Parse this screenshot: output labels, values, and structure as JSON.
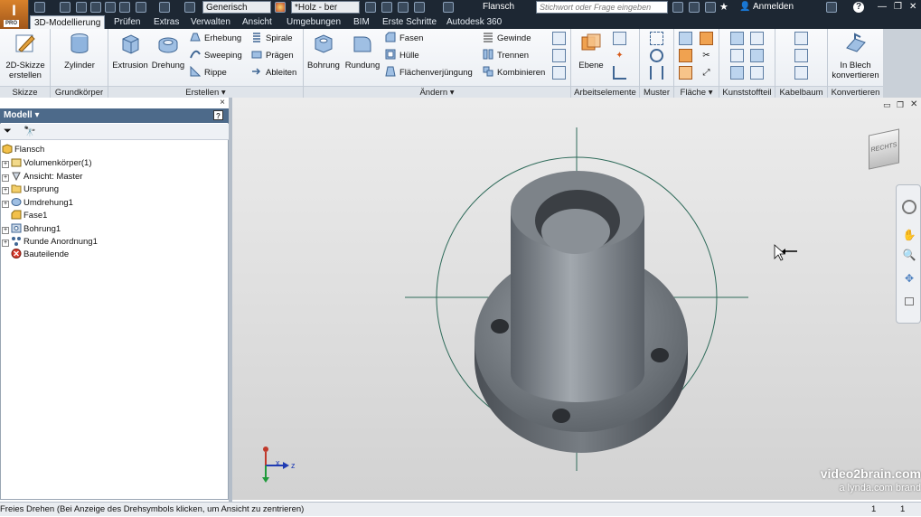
{
  "titlebar": {
    "material": "Generisch",
    "appearance": "*Holz - ber",
    "document": "Flansch",
    "search_placeholder": "Stichwort oder Frage eingeben",
    "signin": "Anmelden"
  },
  "app": {
    "logo_letter": "I",
    "logo_badge": "PRO"
  },
  "tabs": [
    "3D-Modellierung",
    "Prüfen",
    "Extras",
    "Verwalten",
    "Ansicht",
    "Umgebungen",
    "BIM",
    "Erste Schritte",
    "Autodesk 360"
  ],
  "ribbon": {
    "skizze": {
      "title": "Skizze",
      "btn": "2D-Skizze erstellen"
    },
    "grund": {
      "title": "Grundkörper",
      "btn": "Zylinder"
    },
    "erstellen": {
      "title": "Erstellen",
      "extrusion": "Extrusion",
      "drehung": "Drehung",
      "erhebung": "Erhebung",
      "sweeping": "Sweeping",
      "rippe": "Rippe",
      "spirale": "Spirale",
      "praegen": "Prägen",
      "ableiten": "Ableiten"
    },
    "aendern": {
      "title": "Ändern",
      "bohrung": "Bohrung",
      "rundung": "Rundung",
      "fasen": "Fasen",
      "huelle": "Hülle",
      "flaechen": "Flächenverjüngung",
      "gewinde": "Gewinde",
      "trennen": "Trennen",
      "kombinieren": "Kombinieren"
    },
    "arbeit": {
      "title": "Arbeitselemente",
      "ebene": "Ebene"
    },
    "muster": {
      "title": "Muster"
    },
    "flaeche": {
      "title": "Fläche"
    },
    "kunst": {
      "title": "Kunststoffteil"
    },
    "kabel": {
      "title": "Kabelbaum"
    },
    "konv": {
      "title": "Konvertieren",
      "btn": "In Blech konvertieren"
    }
  },
  "browser": {
    "title": "Modell",
    "help": "?",
    "items": [
      {
        "label": "Flansch",
        "indent": 0,
        "icon": "part-icon"
      },
      {
        "label": "Volumenkörper(1)",
        "indent": 1,
        "icon": "solid-bodies-icon"
      },
      {
        "label": "Ansicht: Master",
        "indent": 1,
        "icon": "view-icon"
      },
      {
        "label": "Ursprung",
        "indent": 1,
        "icon": "folder-icon"
      },
      {
        "label": "Umdrehung1",
        "indent": 1,
        "icon": "revolve-icon"
      },
      {
        "label": "Fase1",
        "indent": 1,
        "icon": "chamfer-icon"
      },
      {
        "label": "Bohrung1",
        "indent": 1,
        "icon": "hole-icon"
      },
      {
        "label": "Runde Anordnung1",
        "indent": 1,
        "icon": "circular-pattern-icon"
      },
      {
        "label": "Bauteilende",
        "indent": 1,
        "icon": "end-of-part-icon"
      }
    ]
  },
  "viewcube": {
    "face": "RECHTS"
  },
  "triad": {
    "x": "x",
    "z": "z"
  },
  "watermark": {
    "line1": "video2brain.com",
    "line2": "a lynda.com brand"
  },
  "status": {
    "text": "Freies Drehen (Bei Anzeige des Drehsymbols klicken, um Ansicht zu zentrieren)",
    "n1": "1",
    "n2": "1"
  },
  "colors": {
    "titlebar": "#1d2733",
    "browser_header": "#4d6a8a",
    "accent": "#d9822b"
  }
}
